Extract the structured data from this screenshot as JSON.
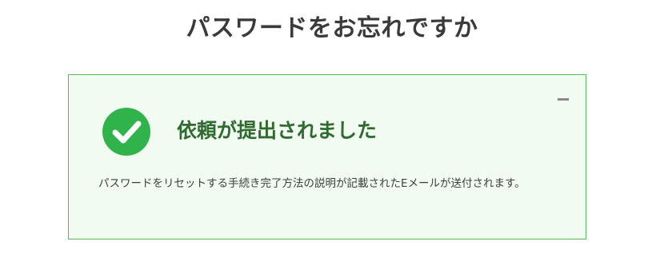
{
  "page": {
    "title": "パスワードをお忘れですか"
  },
  "alert": {
    "heading": "依頼が提出されました",
    "message": "パスワードをリセットする手続き完了方法の説明が記載されたEメールが送付されます。",
    "collapse_icon": "minus-icon",
    "status_icon": "check-circle-icon",
    "colors": {
      "accent": "#5cb85c",
      "icon": "#2fb34a",
      "background": "#f1fbf2",
      "heading": "#2f6b2f"
    }
  }
}
